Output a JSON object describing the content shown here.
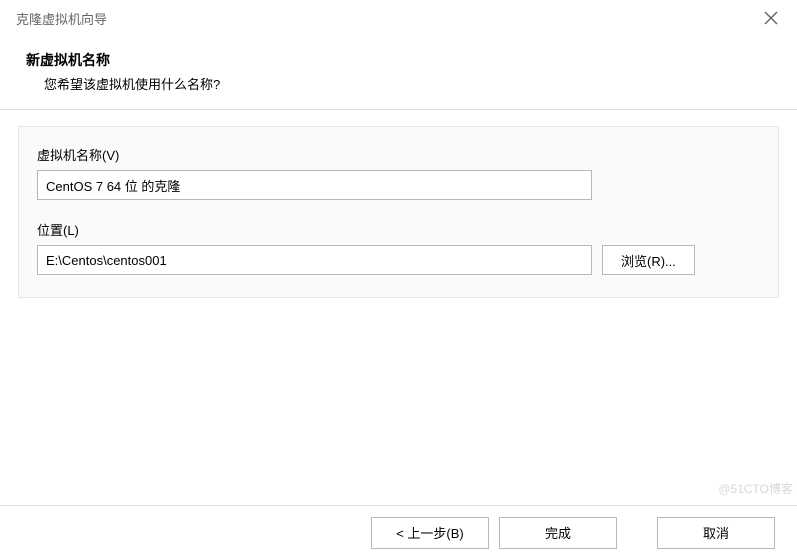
{
  "window": {
    "title": "克隆虚拟机向导"
  },
  "header": {
    "title": "新虚拟机名称",
    "subtitle": "您希望该虚拟机使用什么名称?"
  },
  "fields": {
    "vm_name": {
      "label": "虚拟机名称(V)",
      "value": "CentOS 7 64 位 的克隆"
    },
    "location": {
      "label": "位置(L)",
      "value": "E:\\Centos\\centos001",
      "browse_label": "浏览(R)..."
    }
  },
  "footer": {
    "back_label": "< 上一步(B)",
    "finish_label": "完成",
    "cancel_label": "取消"
  },
  "watermark": "@51CTO博客"
}
